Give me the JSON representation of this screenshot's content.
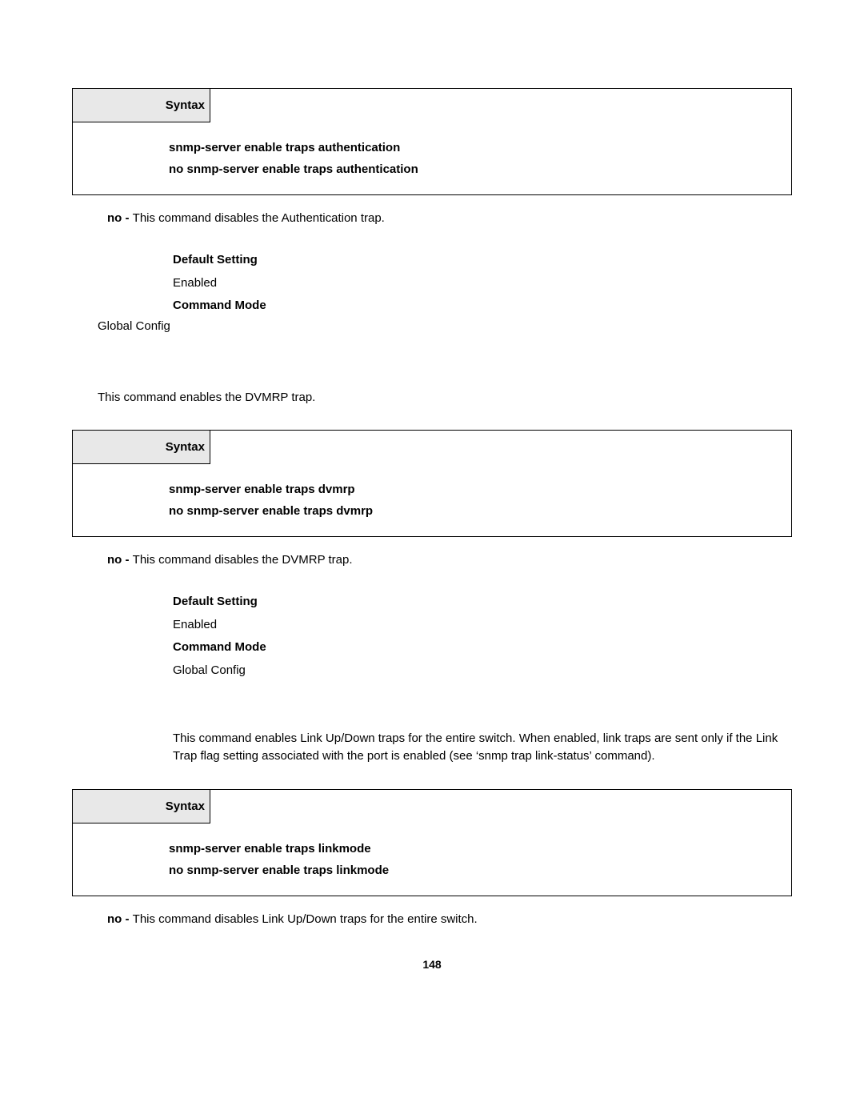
{
  "section1": {
    "syntax_label": "Syntax",
    "syntax_line1": "snmp-server enable traps authentication",
    "syntax_line2": "no snmp-server enable traps authentication",
    "no_prefix": "no - ",
    "no_text": "This command disables the Authentication trap.",
    "default_setting_label": "Default Setting",
    "default_setting_value": "Enabled",
    "command_mode_label": "Command Mode",
    "command_mode_value": "Global Config"
  },
  "section2": {
    "intro": "This command enables the DVMRP trap.",
    "syntax_label": "Syntax",
    "syntax_line1": "snmp-server enable traps dvmrp",
    "syntax_line2": "no snmp-server enable traps dvmrp",
    "no_prefix": "no - ",
    "no_text": "This command disables the DVMRP trap.",
    "default_setting_label": "Default Setting",
    "default_setting_value": "Enabled",
    "command_mode_label": "Command Mode",
    "command_mode_value": "Global Config"
  },
  "section3": {
    "intro": "This command enables Link Up/Down traps for the entire switch. When enabled, link traps are sent only if the Link Trap flag setting associated with the port is enabled (see ‘snmp trap link-status’ command).",
    "syntax_label": "Syntax",
    "syntax_line1": "snmp-server enable traps linkmode",
    "syntax_line2": "no snmp-server enable traps linkmode",
    "no_prefix": "no - ",
    "no_text": "This command disables Link Up/Down traps for the entire switch."
  },
  "page_number": "148"
}
